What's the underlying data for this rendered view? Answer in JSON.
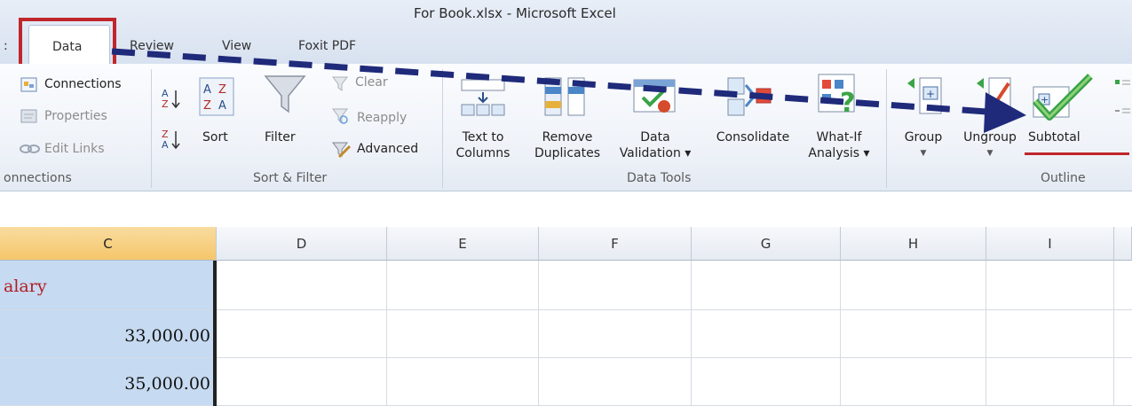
{
  "window": {
    "title": "For Book.xlsx  -  Microsoft Excel"
  },
  "tabs": {
    "partial": ":",
    "items": [
      {
        "label": "Data",
        "active": true
      },
      {
        "label": "Review",
        "active": false
      },
      {
        "label": "View",
        "active": false
      },
      {
        "label": "Foxit PDF",
        "active": false
      }
    ]
  },
  "ribbon": {
    "connections": {
      "items": [
        "Connections",
        "Properties",
        "Edit Links"
      ],
      "group_label": "onnections"
    },
    "sort_filter": {
      "sort_label": "Sort",
      "filter_label": "Filter",
      "clear_label": "Clear",
      "reapply_label": "Reapply",
      "advanced_label": "Advanced",
      "group_label": "Sort & Filter"
    },
    "data_tools": {
      "text_to_columns": [
        "Text to",
        "Columns"
      ],
      "remove_duplicates": [
        "Remove",
        "Duplicates"
      ],
      "data_validation": [
        "Data",
        "Validation ▾"
      ],
      "consolidate": "Consolidate",
      "what_if": [
        "What-If",
        "Analysis ▾"
      ],
      "group_label": "Data Tools"
    },
    "outline": {
      "group_btn": "Group",
      "ungroup_btn": "Ungroup",
      "subtotal_btn": "Subtotal",
      "group_label": "Outline"
    }
  },
  "sheet": {
    "columns": [
      "C",
      "D",
      "E",
      "F",
      "G",
      "H",
      "I"
    ],
    "selected_column": "C",
    "rows": [
      {
        "c": "alary"
      },
      {
        "c": "33,000.00"
      },
      {
        "c": "35,000.00"
      }
    ]
  },
  "colors": {
    "highlight_red": "#c0262b",
    "arrow_blue": "#1f2a7a",
    "header_text_red": "#b01e23",
    "selection_blue": "#c6daf1"
  }
}
